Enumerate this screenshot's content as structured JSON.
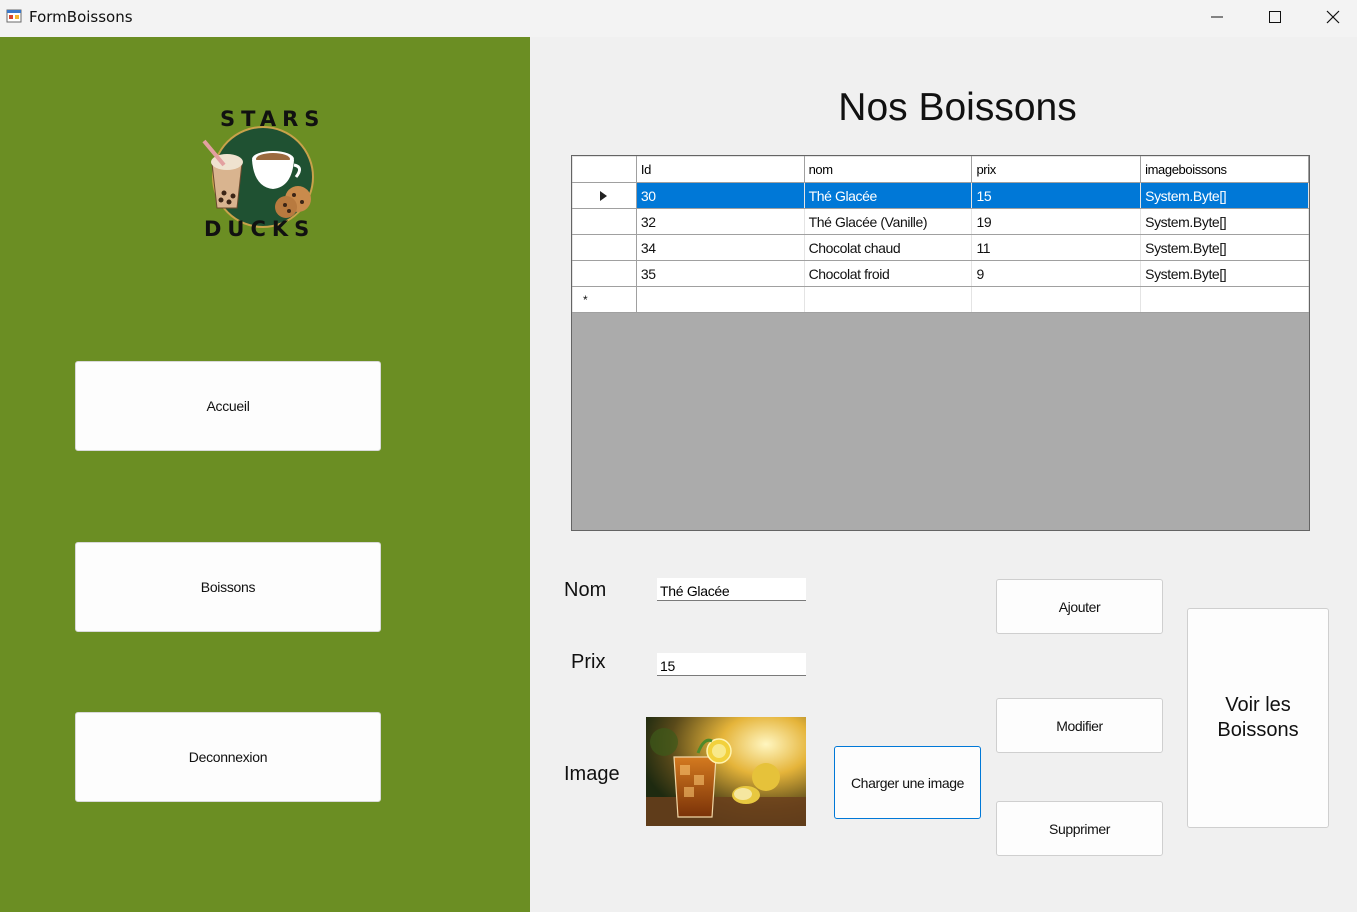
{
  "window": {
    "title": "FormBoissons"
  },
  "logo": {
    "top_text": "STARS",
    "bottom_text": "DUCKS"
  },
  "sidebar": {
    "accueil_label": "Accueil",
    "boissons_label": "Boissons",
    "deconnexion_label": "Deconnexion"
  },
  "page": {
    "title": "Nos Boissons"
  },
  "grid": {
    "columns": [
      "Id",
      "nom",
      "prix",
      "imageboissons"
    ],
    "rows": [
      {
        "id": "30",
        "nom": "Thé Glacée",
        "prix": "15",
        "image": "System.Byte[]",
        "selected": true
      },
      {
        "id": "32",
        "nom": "Thé Glacée (Vanille)",
        "prix": "19",
        "image": "System.Byte[]"
      },
      {
        "id": "34",
        "nom": "Chocolat chaud",
        "prix": "11",
        "image": "System.Byte[]"
      },
      {
        "id": "35",
        "nom": "Chocolat froid",
        "prix": "9",
        "image": "System.Byte[]"
      }
    ],
    "new_row_marker": "*"
  },
  "form": {
    "nom_label": "Nom",
    "nom_value": "Thé Glacée",
    "prix_label": "Prix",
    "prix_value": "15",
    "image_label": "Image",
    "charger_label": "Charger une image"
  },
  "actions": {
    "ajouter_label": "Ajouter",
    "modifier_label": "Modifier",
    "supprimer_label": "Supprimer",
    "voir_label": "Voir les Boissons"
  },
  "colors": {
    "sidebar": "#6b8e23",
    "selection": "#0078d7",
    "grid_background": "#ababab"
  }
}
